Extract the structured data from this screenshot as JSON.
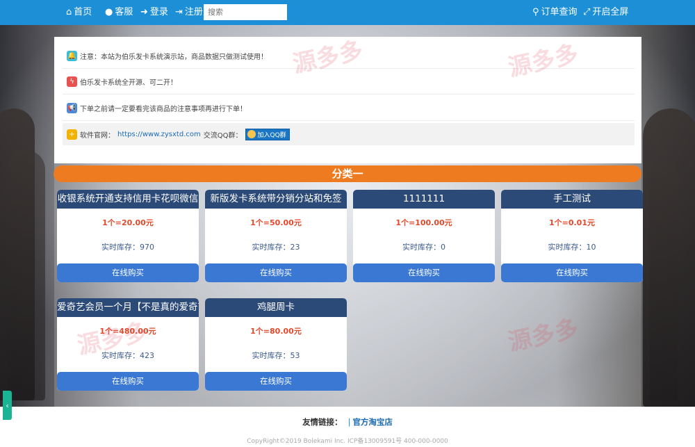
{
  "nav": {
    "home": "首页",
    "service": "客服",
    "login": "登录",
    "register": "注册",
    "search_placeholder": "搜索",
    "order_query": "订单查询",
    "fullscreen": "开启全屏"
  },
  "notices": [
    {
      "text": "注意：本站为伯乐发卡系统演示站，商品数据只做测试使用！",
      "icon": "bell-icon",
      "color": "#3bbcd8"
    },
    {
      "text": "伯乐发卡系统全开源、可二开！",
      "icon": "bolt-icon",
      "color": "#e5524f"
    },
    {
      "text": "下单之前请一定要看完该商品的注意事项再进行下单！",
      "icon": "megaphone-icon",
      "color": "#4c8ad8"
    }
  ],
  "official": {
    "label": "软件官网：",
    "url": "https://www.zysxtd.com",
    "qq_label": "交流QQ群：",
    "qq_button": "加入QQ群",
    "icon_color": "#f2b200"
  },
  "category": {
    "name": "分类一",
    "color": "#ef7b21"
  },
  "products": [
    {
      "title": "收银系统开通支持信用卡花呗微信",
      "price": "1个=20.00元",
      "stock_label": "实时库存：",
      "stock": "970",
      "buy": "在线购买"
    },
    {
      "title": "新版发卡系统带分销分站和免签",
      "price": "1个=50.00元",
      "stock_label": "实时库存：",
      "stock": "23",
      "buy": "在线购买"
    },
    {
      "title": "1111111",
      "price": "1个=100.00元",
      "stock_label": "实时库存：",
      "stock": "0",
      "buy": "在线购买"
    },
    {
      "title": "手工测试",
      "price": "1个=0.01元",
      "stock_label": "实时库存：",
      "stock": "10",
      "buy": "在线购买"
    },
    {
      "title": "爱奇艺会员一个月【不是真的爱奇艺",
      "price": "1个=480.00元",
      "stock_label": "实时库存：",
      "stock": "423",
      "buy": "在线购买"
    },
    {
      "title": "鸡腿周卡",
      "price": "1个=80.00元",
      "stock_label": "实时库存：",
      "stock": "53",
      "buy": "在线购买"
    }
  ],
  "footer": {
    "links_label": "友情链接：",
    "link1": "官方淘宝店",
    "copyright": "CopyRight©2019 Bolekami Inc.    ICP备13009591号    400-000-0000"
  },
  "watermark": "源多多",
  "colors": {
    "nav": "#1c8fd6",
    "card_title": "#2c4a78",
    "buy_button": "#3a78d4",
    "price": "#e2492b"
  }
}
